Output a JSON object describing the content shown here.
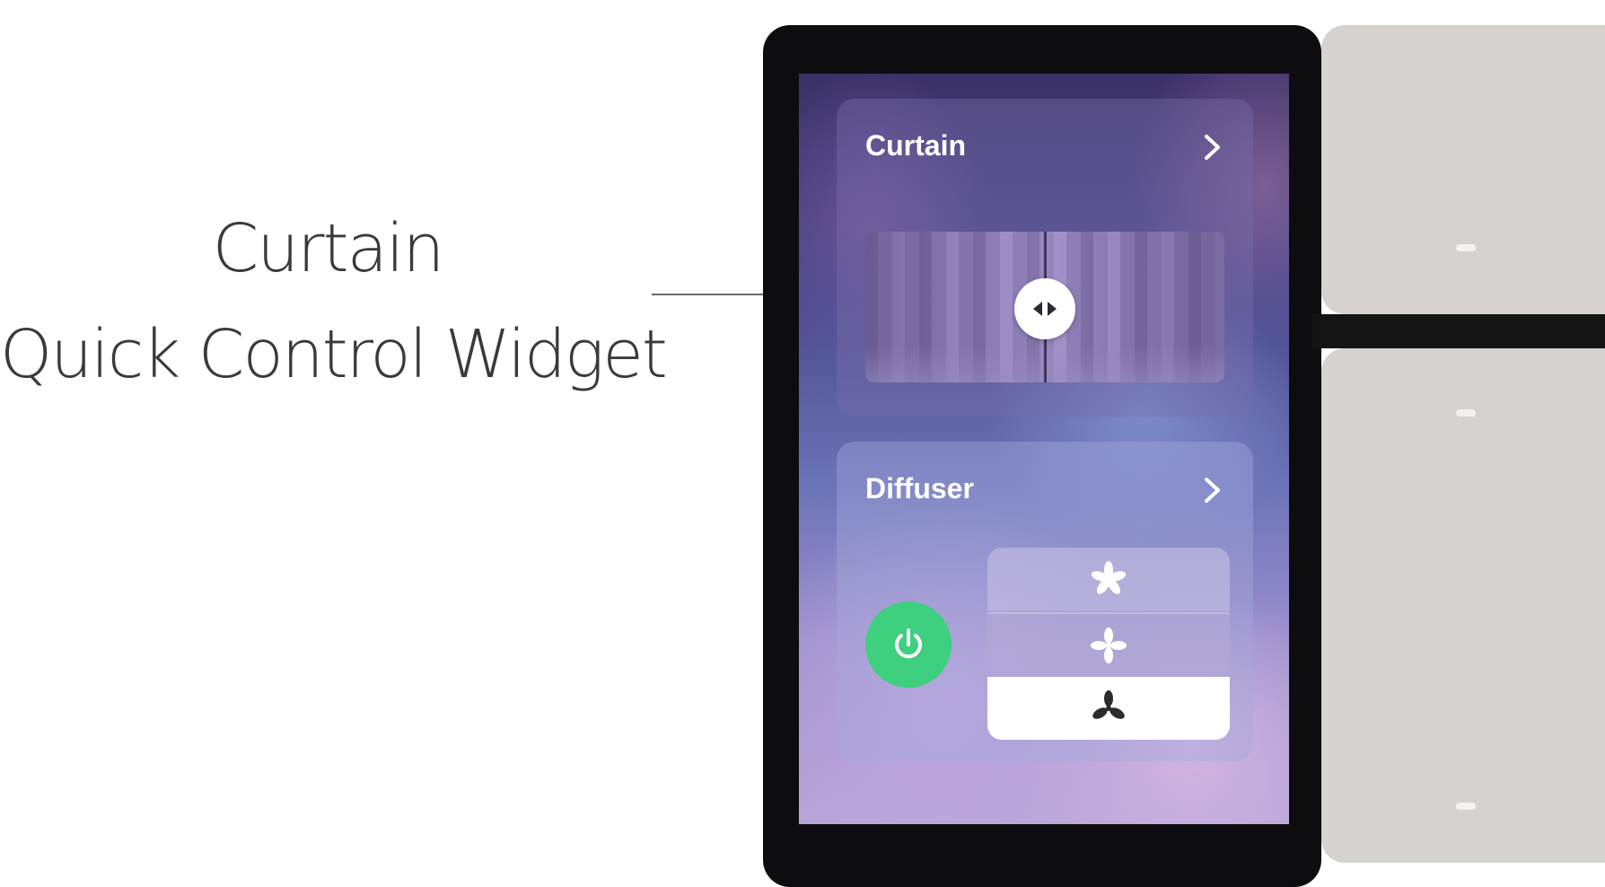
{
  "caption": {
    "line1": "Curtain",
    "line2": "Quick Control Widget"
  },
  "screen": {
    "curtain_widget": {
      "title": "Curtain",
      "chevron_icon": "chevron-right-icon",
      "handle_icon": "left-right-arrows-icon"
    },
    "diffuser_widget": {
      "title": "Diffuser",
      "chevron_icon": "chevron-right-icon",
      "power_icon": "power-icon",
      "power_color": "#3ecf7f",
      "speed_options": [
        {
          "icon": "fan-high-icon",
          "selected": false
        },
        {
          "icon": "fan-medium-icon",
          "selected": false
        },
        {
          "icon": "fan-low-icon",
          "selected": true
        }
      ]
    }
  },
  "colors": {
    "device_frame": "#0d0d0f",
    "wall_panel": "#d5d2cf",
    "power_on": "#3ecf7f"
  }
}
